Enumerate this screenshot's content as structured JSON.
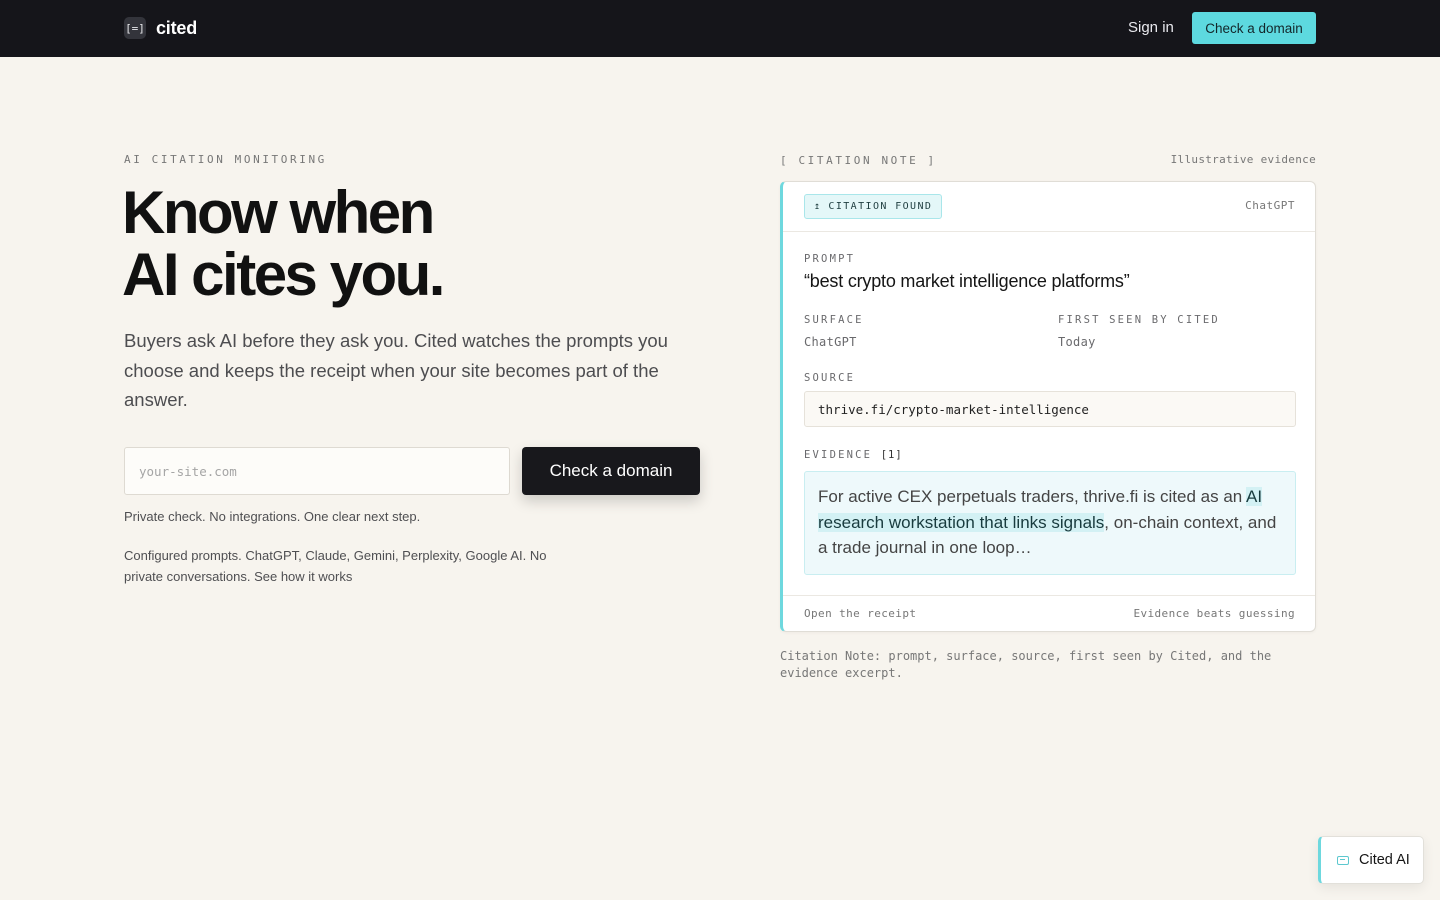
{
  "nav": {
    "logo_mark": "[=]",
    "logo_text": "cited",
    "signin_label": "Sign in",
    "cta_label": "Check a domain"
  },
  "hero": {
    "eyebrow": "AI CITATION MONITORING",
    "headline_line1": "Know when",
    "headline_line2": "AI cites you.",
    "lede": "Buyers ask AI before they ask you. Cited watches the prompts you choose and keeps the receipt when your site becomes part of the answer.",
    "input_placeholder": "your-site.com",
    "cta_label": "Check a domain",
    "private_note": "Private check. No integrations. One clear next step.",
    "config_note": "Configured prompts. ChatGPT, Claude, Gemini, Perplexity, Google AI. No private conversations.",
    "how_link": "See how it works"
  },
  "citation": {
    "eyebrow": "[ CITATION NOTE ]",
    "tag": "Illustrative evidence",
    "badge_icon": "↥",
    "badge_label": "CITATION FOUND",
    "surface_tag": "ChatGPT",
    "prompt_label": "PROMPT",
    "prompt_text": "“best crypto market intelligence platforms”",
    "surface_label": "SURFACE",
    "surface_value": "ChatGPT",
    "first_seen_label": "FIRST SEEN BY CITED",
    "first_seen_value": "Today",
    "source_label": "SOURCE",
    "source_value": "thrive.fi/crypto-market-intelligence",
    "evidence_label": "EVIDENCE",
    "evidence_count": "[1]",
    "evidence_pre": "For active CEX perpetuals traders, thrive.fi is cited as an ",
    "evidence_highlight": "AI research workstation that links signals",
    "evidence_post": ", on-chain context, and a trade journal in one loop…",
    "footer_left": "Open the receipt",
    "footer_right": "Evidence beats guessing",
    "caption": "Citation Note: prompt, surface, source, first seen by Cited, and the evidence excerpt."
  },
  "chat": {
    "label": "Cited AI"
  },
  "colors": {
    "accent": "#5dd9df",
    "nav_bg": "#15151a",
    "page_bg": "#f7f4ee"
  }
}
